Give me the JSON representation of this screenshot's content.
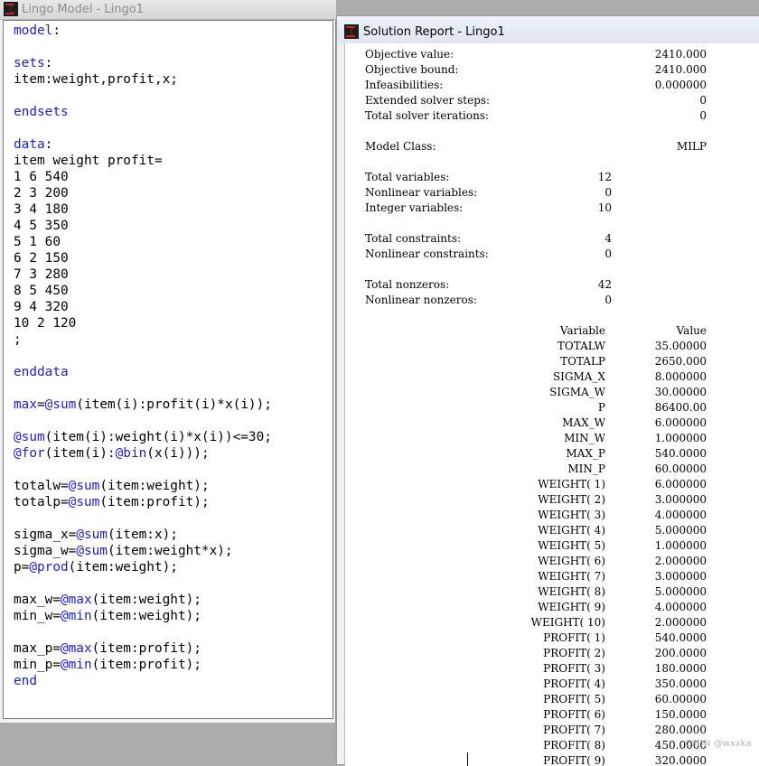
{
  "model_window": {
    "title": "Lingo Model - Lingo1",
    "code_lines": [
      [
        [
          "kw",
          "model"
        ],
        [
          "t",
          ":"
        ]
      ],
      [],
      [
        [
          "kw",
          "sets"
        ],
        [
          "t",
          ":"
        ]
      ],
      [
        [
          "t",
          "item:weight,profit,x;"
        ]
      ],
      [],
      [
        [
          "kw",
          "endsets"
        ]
      ],
      [],
      [
        [
          "kw",
          "data"
        ],
        [
          "t",
          ":"
        ]
      ],
      [
        [
          "t",
          "item weight profit="
        ]
      ],
      [
        [
          "t",
          "1 6 540"
        ]
      ],
      [
        [
          "t",
          "2 3 200"
        ]
      ],
      [
        [
          "t",
          "3 4 180"
        ]
      ],
      [
        [
          "t",
          "4 5 350"
        ]
      ],
      [
        [
          "t",
          "5 1 60"
        ]
      ],
      [
        [
          "t",
          "6 2 150"
        ]
      ],
      [
        [
          "t",
          "7 3 280"
        ]
      ],
      [
        [
          "t",
          "8 5 450"
        ]
      ],
      [
        [
          "t",
          "9 4 320"
        ]
      ],
      [
        [
          "t",
          "10 2 120"
        ]
      ],
      [
        [
          "t",
          ";"
        ]
      ],
      [],
      [
        [
          "kw",
          "enddata"
        ]
      ],
      [],
      [
        [
          "kw",
          "max"
        ],
        [
          "t",
          "="
        ],
        [
          "kw",
          "@sum"
        ],
        [
          "t",
          "(item(i):profit(i)*x(i));"
        ]
      ],
      [],
      [
        [
          "kw",
          "@sum"
        ],
        [
          "t",
          "(item(i):weight(i)*x(i))<=30;"
        ]
      ],
      [
        [
          "kw",
          "@for"
        ],
        [
          "t",
          "(item(i):"
        ],
        [
          "kw",
          "@bin"
        ],
        [
          "t",
          "(x(i)));"
        ]
      ],
      [],
      [
        [
          "t",
          "totalw="
        ],
        [
          "kw",
          "@sum"
        ],
        [
          "t",
          "(item:weight);"
        ]
      ],
      [
        [
          "t",
          "totalp="
        ],
        [
          "kw",
          "@sum"
        ],
        [
          "t",
          "(item:profit);"
        ]
      ],
      [],
      [
        [
          "t",
          "sigma_x="
        ],
        [
          "kw",
          "@sum"
        ],
        [
          "t",
          "(item:x);"
        ]
      ],
      [
        [
          "t",
          "sigma_w="
        ],
        [
          "kw",
          "@sum"
        ],
        [
          "t",
          "(item:weight*x);"
        ]
      ],
      [
        [
          "t",
          "p="
        ],
        [
          "kw",
          "@prod"
        ],
        [
          "t",
          "(item:weight);"
        ]
      ],
      [],
      [
        [
          "t",
          "max_w="
        ],
        [
          "kw",
          "@max"
        ],
        [
          "t",
          "(item:weight);"
        ]
      ],
      [
        [
          "t",
          "min_w="
        ],
        [
          "kw",
          "@min"
        ],
        [
          "t",
          "(item:weight);"
        ]
      ],
      [],
      [
        [
          "t",
          "max_p="
        ],
        [
          "kw",
          "@max"
        ],
        [
          "t",
          "(item:profit);"
        ]
      ],
      [
        [
          "t",
          "min_p="
        ],
        [
          "kw",
          "@min"
        ],
        [
          "t",
          "(item:profit);"
        ]
      ],
      [
        [
          "kw",
          "end"
        ]
      ]
    ]
  },
  "report_window": {
    "title": "Solution Report - Lingo1",
    "summary": [
      {
        "label": "Objective value:",
        "value": "2410.000",
        "col": "right"
      },
      {
        "label": "Objective bound:",
        "value": "2410.000",
        "col": "right"
      },
      {
        "label": "Infeasibilities:",
        "value": "0.000000",
        "col": "right"
      },
      {
        "label": "Extended solver steps:",
        "value": "0",
        "col": "right"
      },
      {
        "label": "Total solver iterations:",
        "value": "0",
        "col": "right"
      },
      {
        "label": "",
        "value": "",
        "col": "right"
      },
      {
        "label": "Model Class:",
        "value": "MILP",
        "col": "right"
      },
      {
        "label": "",
        "value": "",
        "col": "right"
      },
      {
        "label": "Total variables:",
        "value": "12",
        "col": "mid"
      },
      {
        "label": "Nonlinear variables:",
        "value": "0",
        "col": "mid"
      },
      {
        "label": "Integer variables:",
        "value": "10",
        "col": "mid"
      },
      {
        "label": "",
        "value": "",
        "col": "mid"
      },
      {
        "label": "Total constraints:",
        "value": "4",
        "col": "mid"
      },
      {
        "label": "Nonlinear constraints:",
        "value": "0",
        "col": "mid"
      },
      {
        "label": "",
        "value": "",
        "col": "mid"
      },
      {
        "label": "Total nonzeros:",
        "value": "42",
        "col": "mid"
      },
      {
        "label": "Nonlinear nonzeros:",
        "value": "0",
        "col": "mid"
      }
    ],
    "variable_header": {
      "name": "Variable",
      "value": "Value"
    },
    "variables": [
      {
        "name": "TOTALW",
        "value": "35.00000"
      },
      {
        "name": "TOTALP",
        "value": "2650.000"
      },
      {
        "name": "SIGMA_X",
        "value": "8.000000"
      },
      {
        "name": "SIGMA_W",
        "value": "30.00000"
      },
      {
        "name": "P",
        "value": "86400.00"
      },
      {
        "name": "MAX_W",
        "value": "6.000000"
      },
      {
        "name": "MIN_W",
        "value": "1.000000"
      },
      {
        "name": "MAX_P",
        "value": "540.0000"
      },
      {
        "name": "MIN_P",
        "value": "60.00000"
      },
      {
        "name": "WEIGHT( 1)",
        "value": "6.000000"
      },
      {
        "name": "WEIGHT( 2)",
        "value": "3.000000"
      },
      {
        "name": "WEIGHT( 3)",
        "value": "4.000000"
      },
      {
        "name": "WEIGHT( 4)",
        "value": "5.000000"
      },
      {
        "name": "WEIGHT( 5)",
        "value": "1.000000"
      },
      {
        "name": "WEIGHT( 6)",
        "value": "2.000000"
      },
      {
        "name": "WEIGHT( 7)",
        "value": "3.000000"
      },
      {
        "name": "WEIGHT( 8)",
        "value": "5.000000"
      },
      {
        "name": "WEIGHT( 9)",
        "value": "4.000000"
      },
      {
        "name": "WEIGHT( 10)",
        "value": "2.000000"
      },
      {
        "name": "PROFIT( 1)",
        "value": "540.0000"
      },
      {
        "name": "PROFIT( 2)",
        "value": "200.0000"
      },
      {
        "name": "PROFIT( 3)",
        "value": "180.0000"
      },
      {
        "name": "PROFIT( 4)",
        "value": "350.0000"
      },
      {
        "name": "PROFIT( 5)",
        "value": "60.00000"
      },
      {
        "name": "PROFIT( 6)",
        "value": "150.0000"
      },
      {
        "name": "PROFIT( 7)",
        "value": "280.0000"
      },
      {
        "name": "PROFIT( 8)",
        "value": "450.0000"
      },
      {
        "name": "PROFIT( 9)",
        "value": "320.0000"
      }
    ]
  },
  "watermark": "CSDN @wxxka",
  "colors": {
    "keyword": "#1f1fc8",
    "icon_red": "#d42020",
    "icon_dark": "#1b1b1b"
  },
  "icons": {
    "app": "lingo-app-icon"
  }
}
